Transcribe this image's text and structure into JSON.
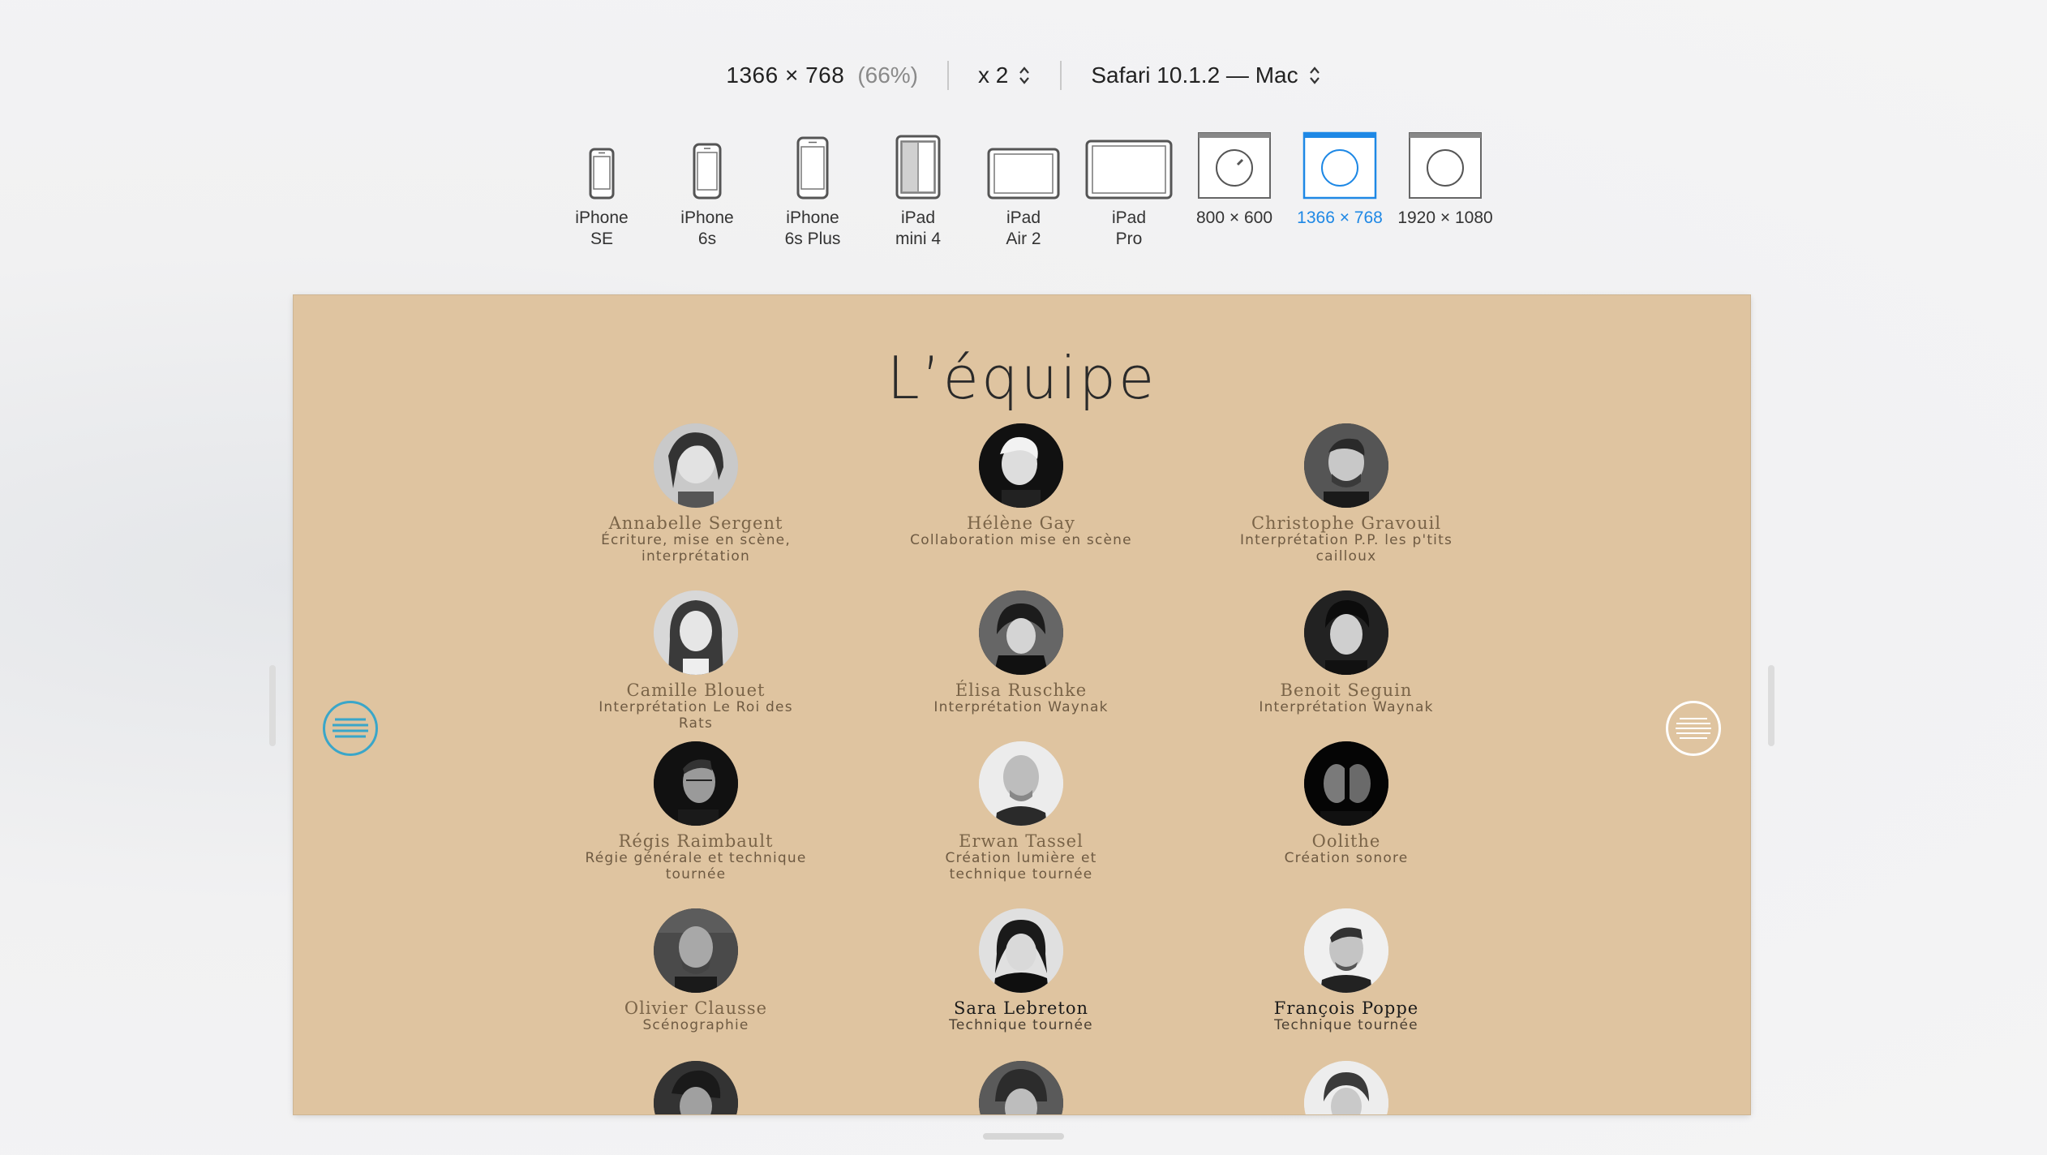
{
  "toolbar": {
    "dimensions": "1366 × 768",
    "scale_percent": "(66%)",
    "pixel_ratio": "x 2",
    "browser": "Safari 10.1.2 — Mac"
  },
  "devices": [
    {
      "label": "iPhone\nSE",
      "icon": "phone-icon",
      "active": false
    },
    {
      "label": "iPhone\n6s",
      "icon": "phone-icon",
      "active": false
    },
    {
      "label": "iPhone\n6s Plus",
      "icon": "phone-icon",
      "active": false
    },
    {
      "label": "iPad\nmini 4",
      "icon": "tablet-icon",
      "active": false
    },
    {
      "label": "iPad\nAir 2",
      "icon": "tablet-landscape-icon",
      "active": false
    },
    {
      "label": "iPad\nPro",
      "icon": "tablet-landscape-icon",
      "active": false
    },
    {
      "label": "800 × 600",
      "icon": "safari-window-icon",
      "active": false
    },
    {
      "label": "1366 × 768",
      "icon": "safari-window-icon",
      "active": true
    },
    {
      "label": "1920 × 1080",
      "icon": "safari-window-icon",
      "active": false
    }
  ],
  "page": {
    "title": "L’équipe",
    "members": [
      {
        "name": "Annabelle Sergent",
        "role": "Écriture, mise en scène, interprétation"
      },
      {
        "name": "Hélène Gay",
        "role": "Collaboration mise en scène"
      },
      {
        "name": "Christophe Gravouil",
        "role": "Interprétation P.P. les p'tits cailloux"
      },
      {
        "name": "Camille Blouet",
        "role": "Interprétation Le Roi des Rats"
      },
      {
        "name": "Élisa Ruschke",
        "role": "Interprétation Waynak"
      },
      {
        "name": "Benoit Seguin",
        "role": "Interprétation Waynak"
      },
      {
        "name": "Régis Raimbault",
        "role": "Régie générale et technique tournée"
      },
      {
        "name": "Erwan Tassel",
        "role": "Création lumière et technique tournée"
      },
      {
        "name": "Oolithe",
        "role": "Création sonore"
      },
      {
        "name": "Olivier Clausse",
        "role": "Scénographie"
      },
      {
        "name": "Sara Lebreton",
        "role": "Technique tournée"
      },
      {
        "name": "François Poppe",
        "role": "Technique tournée"
      }
    ]
  },
  "colors": {
    "page_background": "#dfc4a0",
    "accent_blue": "#1e88e5",
    "menu_left_border": "#3aa6c9"
  }
}
